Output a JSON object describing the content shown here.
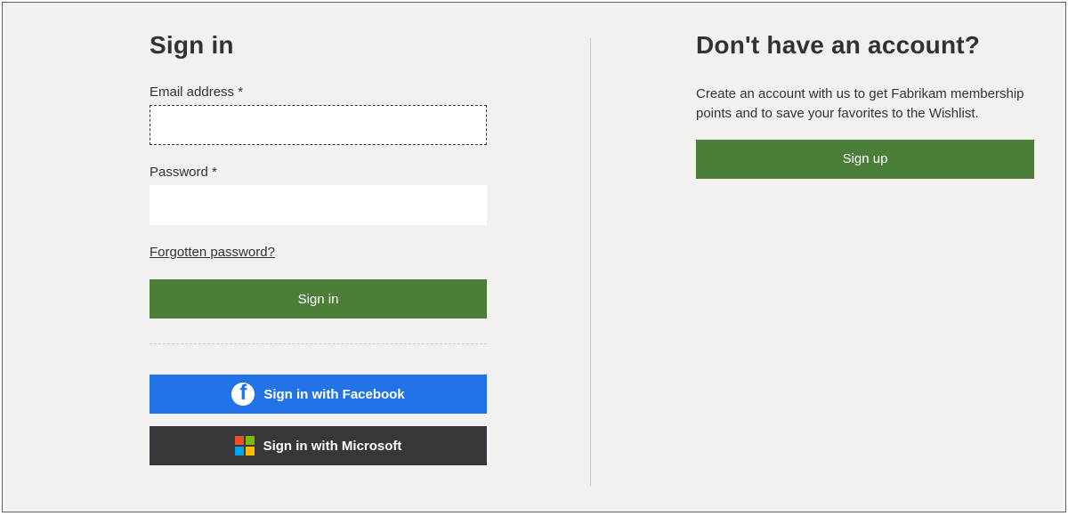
{
  "signin": {
    "heading": "Sign in",
    "emailLabel": "Email address *",
    "emailValue": "",
    "passwordLabel": "Password *",
    "passwordValue": "",
    "forgotLink": "Forgotten password?",
    "submitLabel": "Sign in",
    "facebookLabel": "Sign in with Facebook",
    "microsoftLabel": "Sign in with Microsoft"
  },
  "signup": {
    "heading": "Don't have an account?",
    "description": "Create an account with us to get Fabrikam membership points and to save your favorites to the Wishlist.",
    "buttonLabel": "Sign up"
  },
  "colors": {
    "primary": "#4b7e37",
    "facebook": "#2373e8",
    "microsoft": "#37373b",
    "pageBg": "#f2f1ef"
  }
}
